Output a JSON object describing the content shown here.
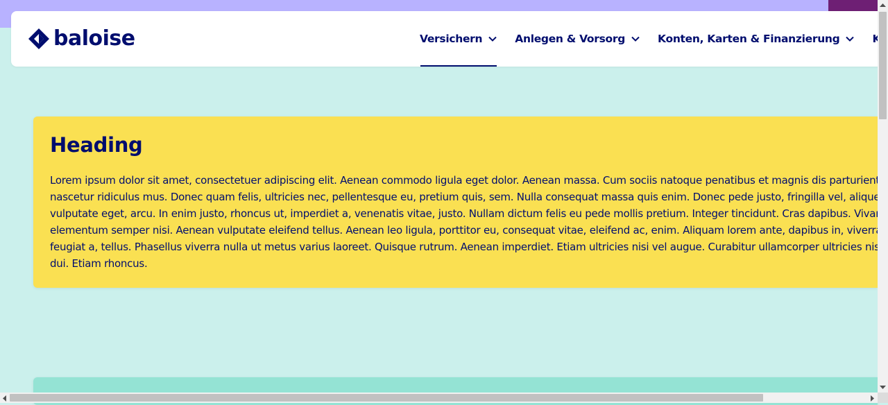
{
  "brand": {
    "name": "baloise",
    "color": "#000d6e"
  },
  "nav": {
    "items": [
      {
        "label": "Versichern",
        "active": true
      },
      {
        "label": "Anlegen & Vorsorg",
        "active": false
      },
      {
        "label": "Konten, Karten & Finanzierung",
        "active": false
      },
      {
        "label": "Kontakt & Service",
        "active": false
      }
    ],
    "icon": "chevron-down-icon"
  },
  "content": {
    "card": {
      "heading": "Heading",
      "lines": [
        "Lorem ipsum dolor sit amet, consectetuer adipiscing elit. Aenean commodo ligula eget dolor. Aenean massa. Cum sociis natoque penatibus et magnis dis parturient montes,",
        "nascetur ridiculus mus. Donec quam felis, ultricies nec, pellentesque eu, pretium quis, sem. Nulla consequat massa quis enim. Donec pede justo, fringilla vel, aliquet nec,",
        "vulputate eget, arcu. In enim justo, rhoncus ut, imperdiet a, venenatis vitae, justo. Nullam dictum felis eu pede mollis pretium. Integer tincidunt. Cras dapibus. Vivamus",
        "elementum semper nisi. Aenean vulputate eleifend tellus. Aenean leo ligula, porttitor eu, consequat vitae, eleifend ac, enim. Aliquam lorem ante, dapibus in, viverra quis,",
        "feugiat a, tellus. Phasellus viverra nulla ut metus varius laoreet. Quisque rutrum. Aenean imperdiet. Etiam ultricies nisi vel augue. Curabitur ullamcorper ultricies nisi. Nam eget",
        "dui. Etiam rhoncus."
      ]
    }
  },
  "colors": {
    "page_background": "#cbf0ec",
    "top_strip": "#b8b2ff",
    "top_strip_accent": "#6e1f74",
    "card_yellow": "#fae052",
    "card_teal": "#94e3d4"
  }
}
